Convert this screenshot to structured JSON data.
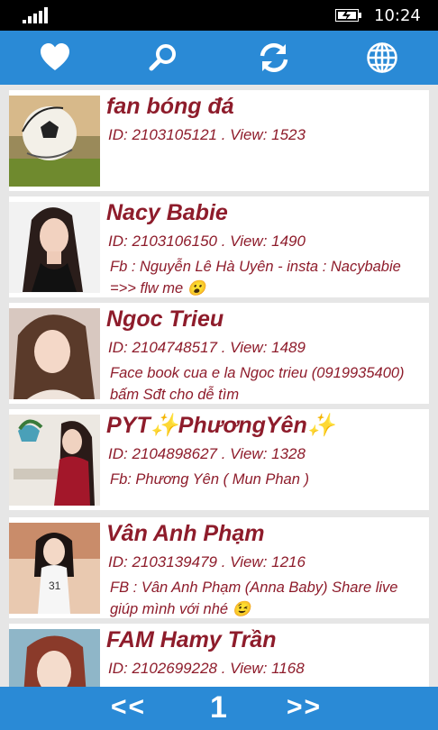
{
  "status_bar": {
    "time": "10:24"
  },
  "toolbar": {
    "icons": [
      "heart-icon",
      "search-icon",
      "refresh-icon",
      "globe-icon"
    ],
    "color": "#2a8ad6"
  },
  "profiles": [
    {
      "name": "fan bóng đá",
      "meta": "ID:  2103105121 . View:  1523",
      "description": ""
    },
    {
      "name": "Nacy Babie",
      "meta": "ID:  2103106150 . View:  1490",
      "description": "Fb : Nguyễn Lê Hà Uyên - insta : Nacybabie =>> flw me 😮"
    },
    {
      "name": "Ngoc Trieu",
      "meta": "ID:  2104748517 . View:  1489",
      "description": "Face book cua e la Ngoc trieu (0919935400) bấm Sđt cho dễ tìm"
    },
    {
      "name": "PYT✨PhươngYên✨",
      "meta": "ID:  2104898627 . View:  1328",
      "description": "Fb: Phương Yên ( Mun Phan )"
    },
    {
      "name": "Vân Anh Phạm",
      "meta": "ID:  2103139479 . View:  1216",
      "description": "FB : Vân Anh Phạm (Anna Baby) Share live giúp mình với nhé 😉"
    },
    {
      "name": "FAM Hamy Trần",
      "meta": "ID:  2102699228 . View:  1168",
      "description": ""
    }
  ],
  "pager": {
    "prev": "<<",
    "page": "1",
    "next": ">>"
  }
}
